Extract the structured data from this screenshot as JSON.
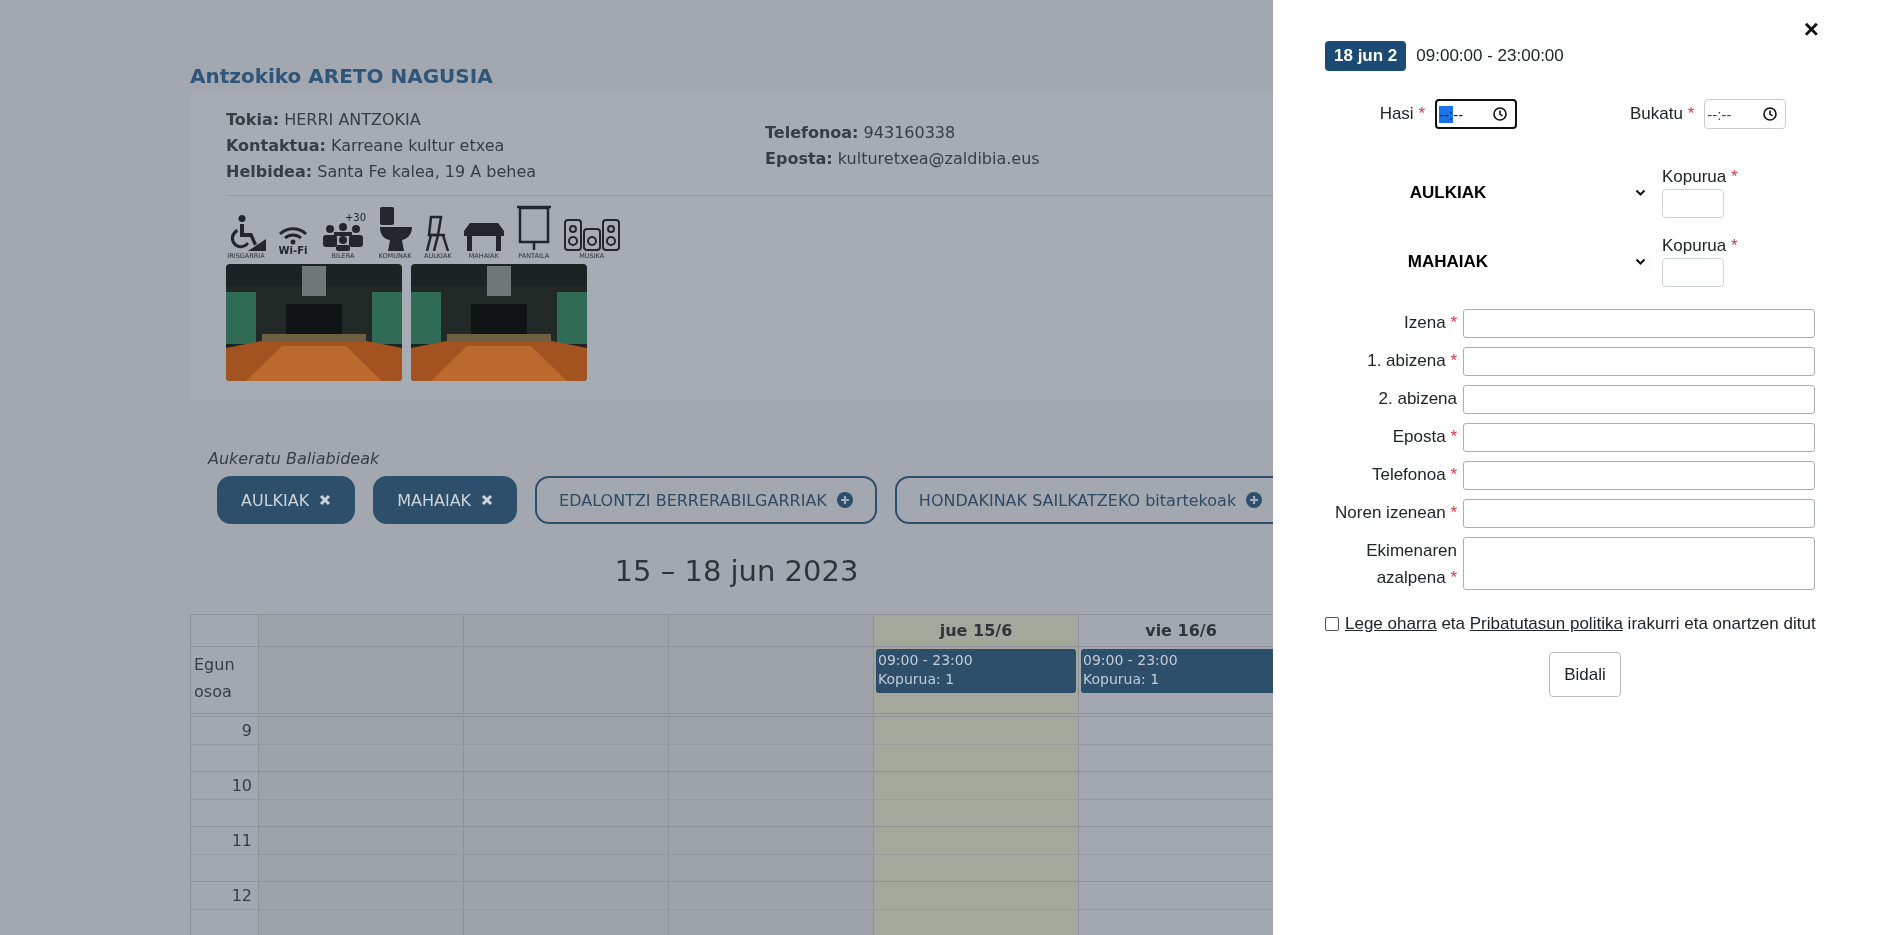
{
  "venue": {
    "title": "Antzokiko ARETO NAGUSIA",
    "info_left": [
      {
        "label": "Tokia:",
        "value": "HERRI ANTZOKIA"
      },
      {
        "label": "Kontaktua:",
        "value": "Karreane kultur etxea"
      },
      {
        "label": "Helbidea:",
        "value": "Santa Fe kalea, 19 A behea"
      }
    ],
    "info_right": [
      {
        "label": "Telefonoa:",
        "value": "943160338"
      },
      {
        "label": "Eposta:",
        "value": "kulturetxea@zaldibia.eus"
      }
    ],
    "amenities": [
      {
        "kind": "wheelchair",
        "label": "IRISGARRIA"
      },
      {
        "kind": "wifi",
        "icon_text": "Wi-Fi"
      },
      {
        "kind": "meeting",
        "label": "BILERA",
        "icon_text": "+30"
      },
      {
        "kind": "toilet",
        "label": "KOMUNAK"
      },
      {
        "kind": "chair",
        "label": "AULKIAK"
      },
      {
        "kind": "table",
        "label": "MAHAIAK"
      },
      {
        "kind": "screen",
        "label": "PANTAILA"
      },
      {
        "kind": "speakers",
        "label": "MUSIKA"
      }
    ]
  },
  "resources": {
    "heading": "Aukeratu Baliabideak",
    "chips": [
      {
        "label": "AULKIAK",
        "selected": true
      },
      {
        "label": "MAHAIAK",
        "selected": true
      },
      {
        "label": "EDALONTZI BERRERABILGARRIAK",
        "selected": false
      },
      {
        "label": "HONDAKINAK SAILKATZEKO bitartekoak",
        "selected": false
      }
    ]
  },
  "calendar": {
    "title": "15 – 18 jun 2023",
    "all_day_label": "Egun osoa",
    "hours": [
      "9",
      "10",
      "11",
      "12"
    ],
    "days": [
      {
        "kind": "past"
      },
      {
        "kind": "past"
      },
      {
        "kind": "past"
      },
      {
        "kind": "today",
        "label": "jue 15/6",
        "event": {
          "time": "09:00 - 23:00",
          "amount": "Kopurua: 1"
        }
      },
      {
        "kind": "future",
        "label": "vie 16/6",
        "event": {
          "time": "09:00 - 23:00",
          "amount": "Kopurua: 1"
        }
      }
    ]
  },
  "panel": {
    "close": "×",
    "required_mark": "*",
    "date_badge": "18 jun 2",
    "time_range": "09:00:00 - 23:00:00",
    "times": [
      {
        "label": "Hasi",
        "required": true,
        "placeholder": "--:--",
        "focused": true
      },
      {
        "label": "Bukatu",
        "required": true,
        "placeholder": "--:--",
        "focused": false
      }
    ],
    "resources": [
      {
        "name": "AULKIAK",
        "qty_label": "Kopurua",
        "required": true
      },
      {
        "name": "MAHAIAK",
        "qty_label": "Kopurua",
        "required": true
      }
    ],
    "fields": [
      {
        "label": "Izena",
        "required": true,
        "kind": "input"
      },
      {
        "label": "1. abizena",
        "required": true,
        "kind": "input"
      },
      {
        "label": "2. abizena",
        "required": false,
        "kind": "input"
      },
      {
        "label": "Eposta",
        "required": true,
        "kind": "input"
      },
      {
        "label": "Telefonoa",
        "required": true,
        "kind": "input"
      },
      {
        "label": "Noren izenean",
        "required": true,
        "kind": "input"
      },
      {
        "label": "Ekimenaren azalpena",
        "required": true,
        "kind": "textarea"
      }
    ],
    "consent": {
      "checked": false,
      "parts": [
        {
          "text": "Lege oharra",
          "link": true
        },
        {
          "text": " eta ",
          "link": false
        },
        {
          "text": "Pribatutasun politika",
          "link": true
        },
        {
          "text": " irakurri eta onartzen ditut",
          "link": false
        }
      ]
    },
    "submit": "Bidali"
  }
}
